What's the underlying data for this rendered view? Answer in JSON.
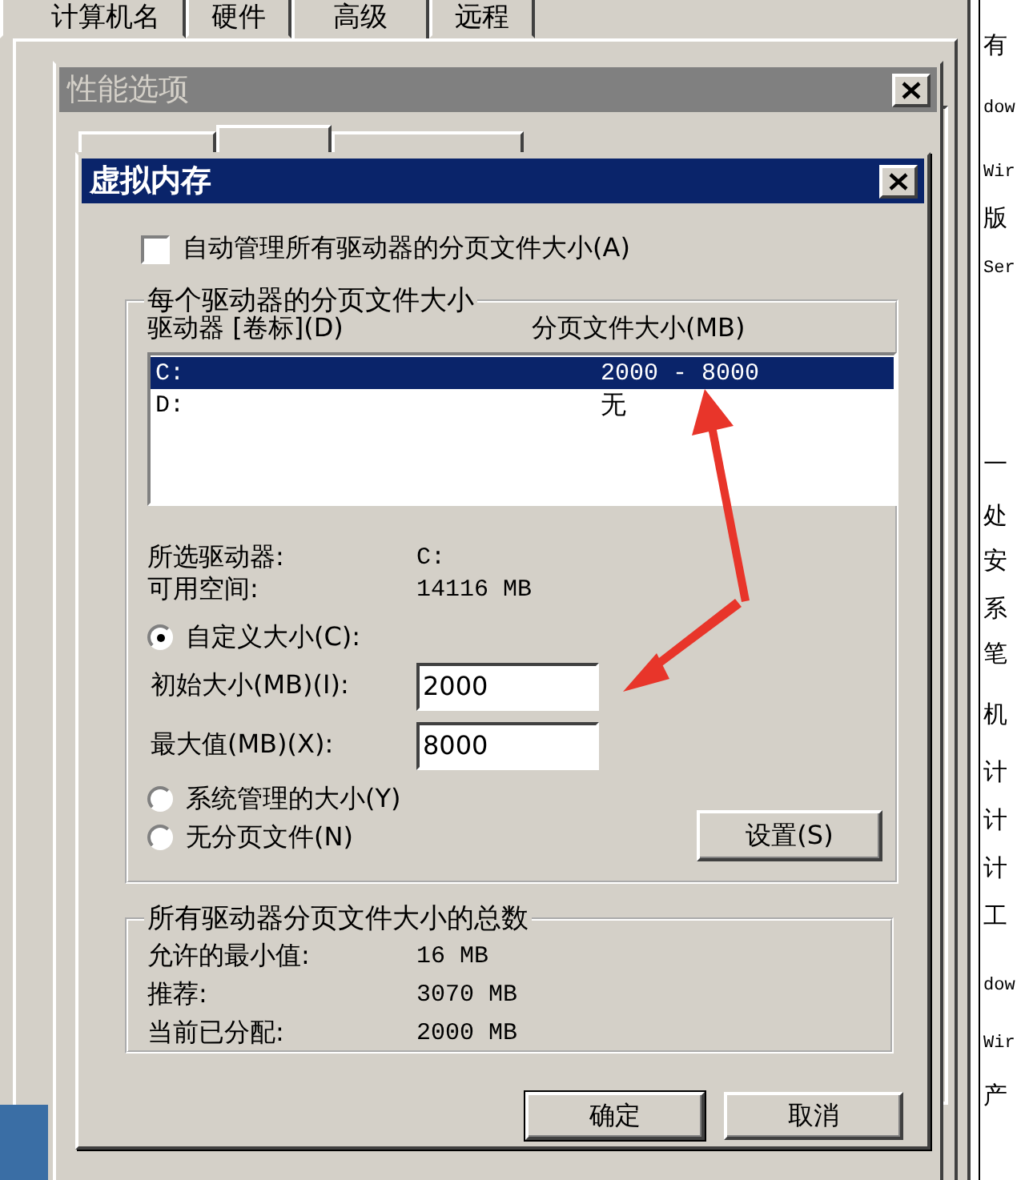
{
  "background_window": {
    "tabs": [
      {
        "label": "计算机名",
        "selected": false
      },
      {
        "label": "硬件",
        "selected": false
      },
      {
        "label": "高级",
        "selected": true
      },
      {
        "label": "远程",
        "selected": false
      }
    ],
    "side_panel_lines": [
      "有",
      "dow",
      "Wir",
      "版",
      "Ser",
      "—",
      "处",
      "安",
      "系",
      "笔",
      "机",
      "计",
      "计",
      "计",
      "工",
      "dow",
      "Wir",
      "产"
    ]
  },
  "performance_window": {
    "title": "性能选项",
    "tabs": [
      {
        "selected": false
      },
      {
        "selected": true
      },
      {
        "selected": false
      }
    ]
  },
  "dialog": {
    "title": "虚拟内存",
    "auto_manage": {
      "label": "自动管理所有驱动器的分页文件大小(A)",
      "checked": false
    },
    "per_drive": {
      "title": "每个驱动器的分页文件大小",
      "columns": [
        "驱动器 [卷标](D)",
        "分页文件大小(MB)"
      ],
      "rows": [
        {
          "drive": "C:",
          "size": "2000 - 8000",
          "selected": true
        },
        {
          "drive": "D:",
          "size": "无",
          "selected": false
        }
      ],
      "selected_drive": {
        "label": "所选驱动器:",
        "value": "C:"
      },
      "free_space": {
        "label": "可用空间:",
        "value": "14116 MB"
      },
      "options": [
        {
          "label": "自定义大小(C):",
          "selected": true
        },
        {
          "label": "系统管理的大小(Y)",
          "selected": false
        },
        {
          "label": "无分页文件(N)",
          "selected": false
        }
      ],
      "initial_size": {
        "label": "初始大小(MB)(I):",
        "value": "2000"
      },
      "maximum_size": {
        "label": "最大值(MB)(X):",
        "value": "8000"
      },
      "set_button": "设置(S)"
    },
    "totals": {
      "title": "所有驱动器分页文件大小的总数",
      "rows": [
        {
          "label": "允许的最小值:",
          "value": "16 MB"
        },
        {
          "label": "推荐:",
          "value": "3070 MB"
        },
        {
          "label": "当前已分配:",
          "value": "2000 MB"
        }
      ]
    },
    "buttons": [
      "确定",
      "取消"
    ]
  }
}
